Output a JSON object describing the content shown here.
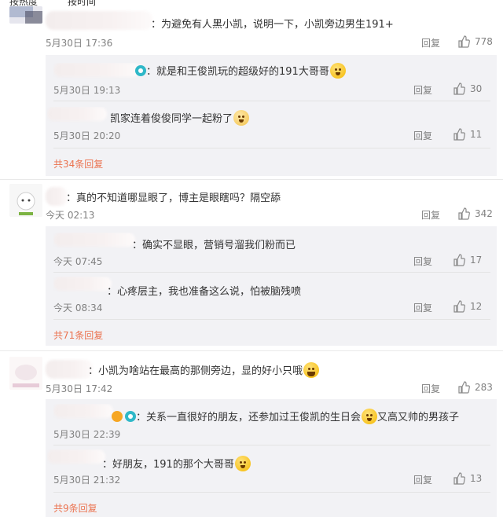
{
  "topbar": {
    "tab1": "按热度",
    "tab2": "按时间"
  },
  "labels": {
    "reply": "回复"
  },
  "comments": [
    {
      "text": "：为避免有人黑小凯，说明一下，小凯旁边男生191+",
      "time": "5月30日 17:36",
      "likes": "778",
      "replies": [
        {
          "text": "：就是和王俊凯玩的超级好的191大哥哥",
          "time": "5月30日 19:13",
          "likes": "30"
        },
        {
          "text": "凯家连着俊俊同学一起粉了",
          "time": "5月30日 20:20",
          "likes": "11"
        }
      ],
      "more": "共34条回复"
    },
    {
      "text": "：真的不知道哪显眼了，博主是眼瞎吗？隔空舔",
      "time": "今天 02:13",
      "likes": "342",
      "replies": [
        {
          "text": "：确实不显眼，营销号溜我们粉而已",
          "time": "今天 07:45",
          "likes": "17"
        },
        {
          "text": "：心疼层主，我也准备这么说，怕被脑残喷",
          "time": "今天 08:34",
          "likes": "12"
        }
      ],
      "more": "共71条回复"
    },
    {
      "text": "：小凯为啥站在最高的那侧旁边，显的好小只哦",
      "time": "5月30日 17:42",
      "likes": "283",
      "replies": [
        {
          "text": "：关系一直很好的朋友，还参加过王俊凯的生日会",
          "text2": "又高又帅的男孩子",
          "time": "5月30日 22:39",
          "likes": ""
        },
        {
          "text": "：好朋友，191的那个大哥哥",
          "time": "5月30日 21:32",
          "likes": "13"
        }
      ],
      "more": "共9条回复"
    }
  ]
}
